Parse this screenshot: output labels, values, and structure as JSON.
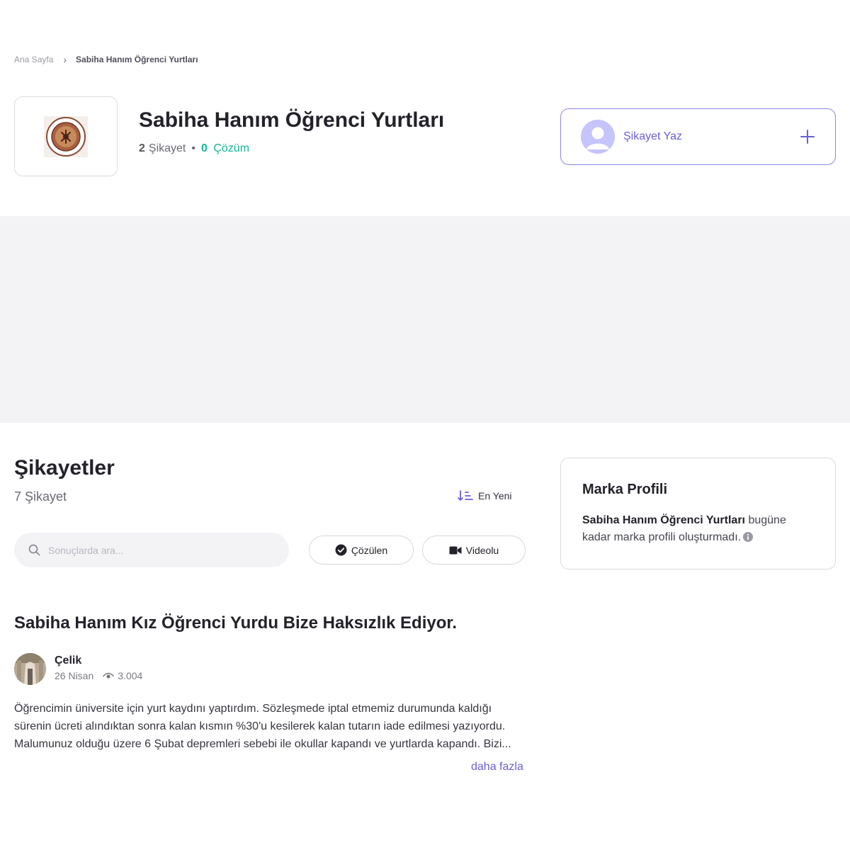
{
  "breadcrumb": {
    "home": "Ana Sayfa",
    "current": "Sabiha Hanım Öğrenci Yurtları"
  },
  "brand": {
    "name": "Sabiha Hanım Öğrenci Yurtları",
    "complaint_count": "2",
    "complaint_label": "Şikayet",
    "resolved_count": "0",
    "resolved_label": "Çözüm",
    "logo_icon": "sabiha-hanim-seal-logo"
  },
  "write_complaint": {
    "label": "Şikayet Yaz",
    "icon": "plus-icon"
  },
  "complaints_section": {
    "title": "Şikayetler",
    "count_text": "7 Şikayet",
    "sort_label": "En Yeni",
    "search_placeholder": "Sonuçlarda ara...",
    "filters": {
      "resolved": "Çözülen",
      "video": "Videolu"
    }
  },
  "brand_profile": {
    "title": "Marka Profili",
    "brand_name": "Sabiha Hanım Öğrenci Yurtları",
    "text": " bugüne kadar marka profili oluşturmadı."
  },
  "complaint": {
    "title": "Sabiha Hanım Kız Öğrenci Yurdu Bize Haksızlık Ediyor.",
    "author": "Çelik",
    "date": "26 Nisan",
    "views": "3.004",
    "body": "Öğrencimin üniversite için yurt kaydını yaptırdım. Sözleşmede iptal etmemiz durumunda kaldığı sürenin ücreti alındıktan sonra kalan kısmın %30'u kesilerek kalan tutarın iade edilmesi yazıyordu. Malumunuz olduğu üzere 6 Şubat depremleri sebebi ile okullar kapandı ve yurtlarda kapandı. Bizi...",
    "read_more": "daha fazla"
  },
  "colors": {
    "accent": "#6a5fd8",
    "success": "#13b797",
    "ad_background": "#f3f3f6"
  }
}
